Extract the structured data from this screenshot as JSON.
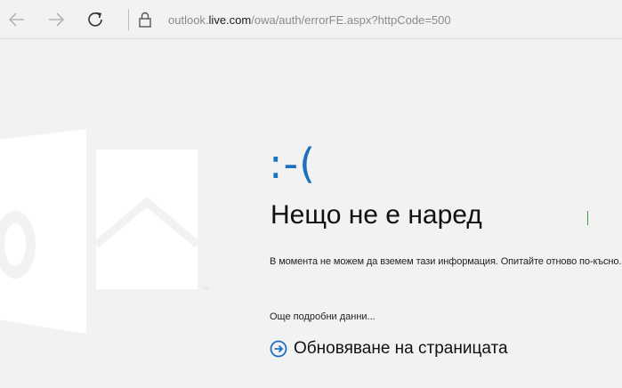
{
  "browser": {
    "url_domain": "outlook.live.com",
    "url_path": "/owa/auth/errorFE.aspx?httpCode=500",
    "url_prefix": "outlook."
  },
  "icons": {
    "back": "back-arrow-icon",
    "forward": "forward-arrow-icon",
    "refresh": "refresh-icon",
    "lock": "lock-icon",
    "logo": "outlook-logo-icon",
    "link_arrow": "arrow-circle-right-icon"
  },
  "colors": {
    "accent": "#1f6fc0",
    "background": "#f2f2f2",
    "logo": "#ffffff"
  },
  "error": {
    "face": ":-(",
    "title": "Нещо не е наред",
    "message": "В момента не можем да вземем тази информация. Опитайте отново по-късно.",
    "more_details": "Още подробни данни...",
    "refresh_label": "Обновяване на страницата"
  },
  "logo": {
    "trademark": "TM"
  }
}
